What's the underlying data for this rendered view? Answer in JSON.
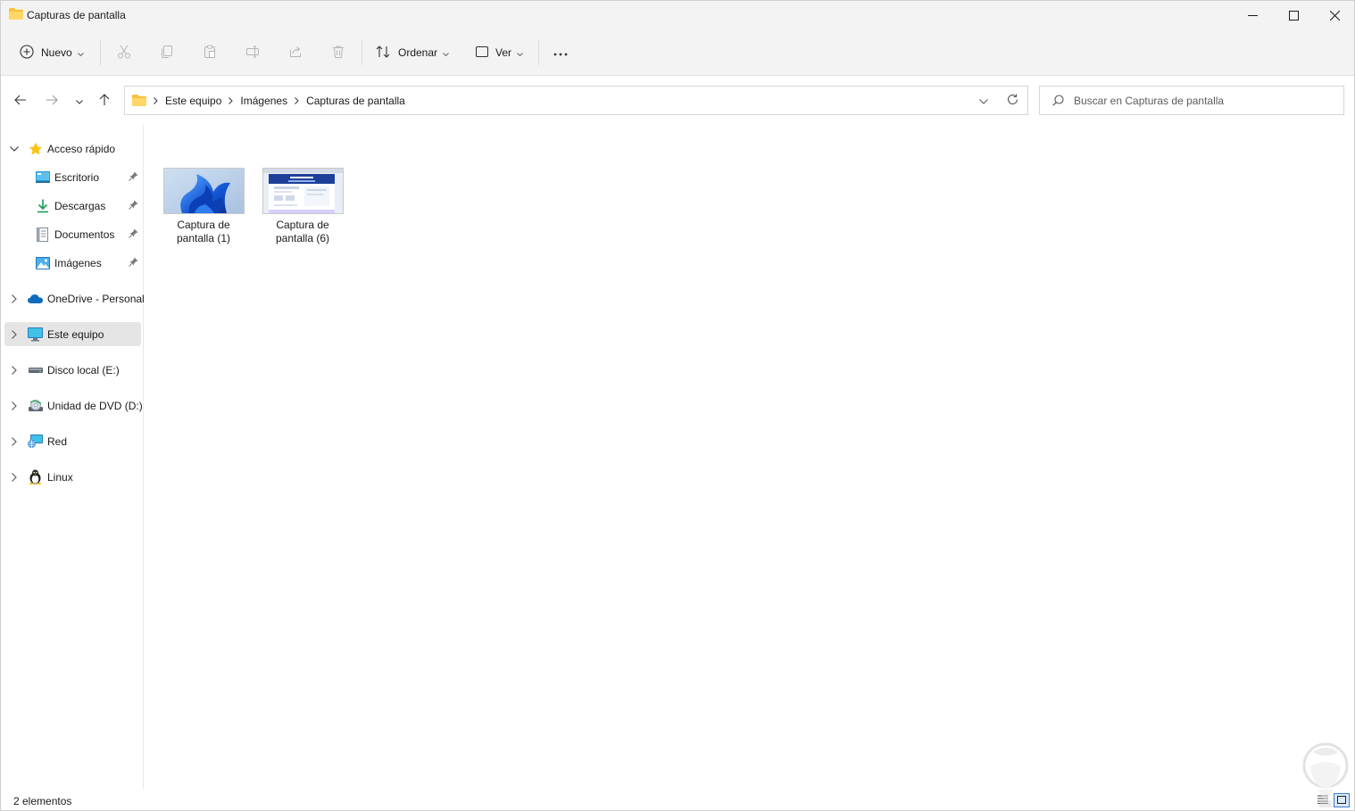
{
  "window": {
    "title": "Capturas de pantalla"
  },
  "toolbar": {
    "new_label": "Nuevo",
    "sort_label": "Ordenar",
    "view_label": "Ver",
    "more_label": "···"
  },
  "breadcrumb": {
    "items": [
      "Este equipo",
      "Imágenes",
      "Capturas de pantalla"
    ]
  },
  "search": {
    "placeholder": "Buscar en Capturas de pantalla"
  },
  "sidebar": {
    "items": [
      {
        "label": "Acceso rápido",
        "icon": "star-icon"
      },
      {
        "label": "Escritorio",
        "icon": "desktop-icon"
      },
      {
        "label": "Descargas",
        "icon": "download-icon"
      },
      {
        "label": "Documentos",
        "icon": "document-icon"
      },
      {
        "label": "Imágenes",
        "icon": "pictures-icon"
      },
      {
        "label": "OneDrive - Personal",
        "icon": "onedrive-icon"
      },
      {
        "label": "Este equipo",
        "icon": "computer-icon"
      },
      {
        "label": "Disco local (E:)",
        "icon": "drive-icon"
      },
      {
        "label": "Unidad de DVD (D:)",
        "icon": "dvd-icon"
      },
      {
        "label": "Red",
        "icon": "network-icon"
      },
      {
        "label": "Linux",
        "icon": "linux-icon"
      }
    ],
    "selected": "Este equipo"
  },
  "files": [
    {
      "line1": "Captura de",
      "line2": "pantalla (1)"
    },
    {
      "line1": "Captura de",
      "line2": "pantalla (6)"
    }
  ],
  "status": {
    "count": "2 elementos"
  },
  "colors": {
    "accent": "#0078d4",
    "folder": "#f8c33b",
    "selection": "#e5e5e5"
  }
}
